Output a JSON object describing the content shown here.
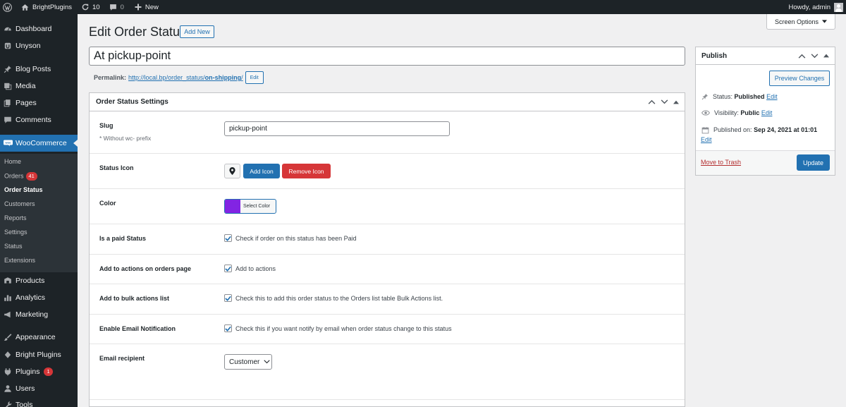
{
  "admin_bar": {
    "site_name": "BrightPlugins",
    "updates_count": "10",
    "comments_count": "0",
    "new_label": "New",
    "greeting": "Howdy, admin"
  },
  "sidebar": {
    "items": [
      {
        "label": "Dashboard",
        "icon": "dashboard-icon"
      },
      {
        "label": "Unyson",
        "icon": "unyson-icon"
      },
      {
        "label": "Blog Posts",
        "icon": "pin-icon"
      },
      {
        "label": "Media",
        "icon": "media-icon"
      },
      {
        "label": "Pages",
        "icon": "pages-icon"
      },
      {
        "label": "Comments",
        "icon": "comments-icon"
      },
      {
        "label": "WooCommerce",
        "icon": "woo-icon"
      },
      {
        "label": "Products",
        "icon": "products-icon"
      },
      {
        "label": "Analytics",
        "icon": "analytics-icon"
      },
      {
        "label": "Marketing",
        "icon": "megaphone-icon"
      },
      {
        "label": "Appearance",
        "icon": "brush-icon"
      },
      {
        "label": "Bright Plugins",
        "icon": "bright-plugins-icon"
      },
      {
        "label": "Plugins",
        "icon": "plugin-icon",
        "badge": "1"
      },
      {
        "label": "Users",
        "icon": "users-icon"
      },
      {
        "label": "Tools",
        "icon": "tools-icon"
      }
    ],
    "submenu": [
      {
        "label": "Home"
      },
      {
        "label": "Orders",
        "badge": "41"
      },
      {
        "label": "Order Status"
      },
      {
        "label": "Customers"
      },
      {
        "label": "Reports"
      },
      {
        "label": "Settings"
      },
      {
        "label": "Status"
      },
      {
        "label": "Extensions"
      }
    ]
  },
  "header": {
    "title": "Edit Order Status",
    "add_new": "Add New",
    "screen_options": "Screen Options"
  },
  "post": {
    "title": "At pickup-point",
    "permalink_label": "Permalink:",
    "permalink_base": "http://local.bp/order_status/",
    "permalink_slug": "on-shipping",
    "permalink_tail": "/",
    "permalink_edit": "Edit"
  },
  "settings": {
    "title": "Order Status Settings",
    "slug_label": "Slug",
    "slug_hint": "* Without wc- prefix",
    "slug_value": "pickup-point",
    "icon_label": "Status Icon",
    "add_icon": "Add Icon",
    "remove_icon": "Remove Icon",
    "color_label": "Color",
    "color_value": "#8224e3",
    "select_color": "Select Color",
    "paid_label": "Is a paid Status",
    "paid_text": "Check if order on this status has been Paid",
    "paid_checked": true,
    "actions_label": "Add to actions on orders page",
    "actions_text": "Add to actions",
    "actions_checked": true,
    "bulk_label": "Add to bulk actions list",
    "bulk_text": "Check this to add this order status to the Orders list table Bulk Actions list.",
    "bulk_checked": true,
    "email_label": "Enable Email Notification",
    "email_text": "Check this if you want notify by email when order status change to this status",
    "email_checked": true,
    "recipient_label": "Email recipient",
    "recipient_value": "Customer"
  },
  "publish": {
    "title": "Publish",
    "preview": "Preview Changes",
    "status_label": "Status:",
    "status_value": "Published",
    "visibility_label": "Visibility:",
    "visibility_value": "Public",
    "published_label": "Published on:",
    "published_value": "Sep 24, 2021 at 01:01",
    "edit": "Edit",
    "trash": "Move to Trash",
    "update": "Update"
  },
  "colors": {
    "accent": "#2271b1",
    "danger": "#d63638",
    "admin_dark": "#1d2327"
  }
}
